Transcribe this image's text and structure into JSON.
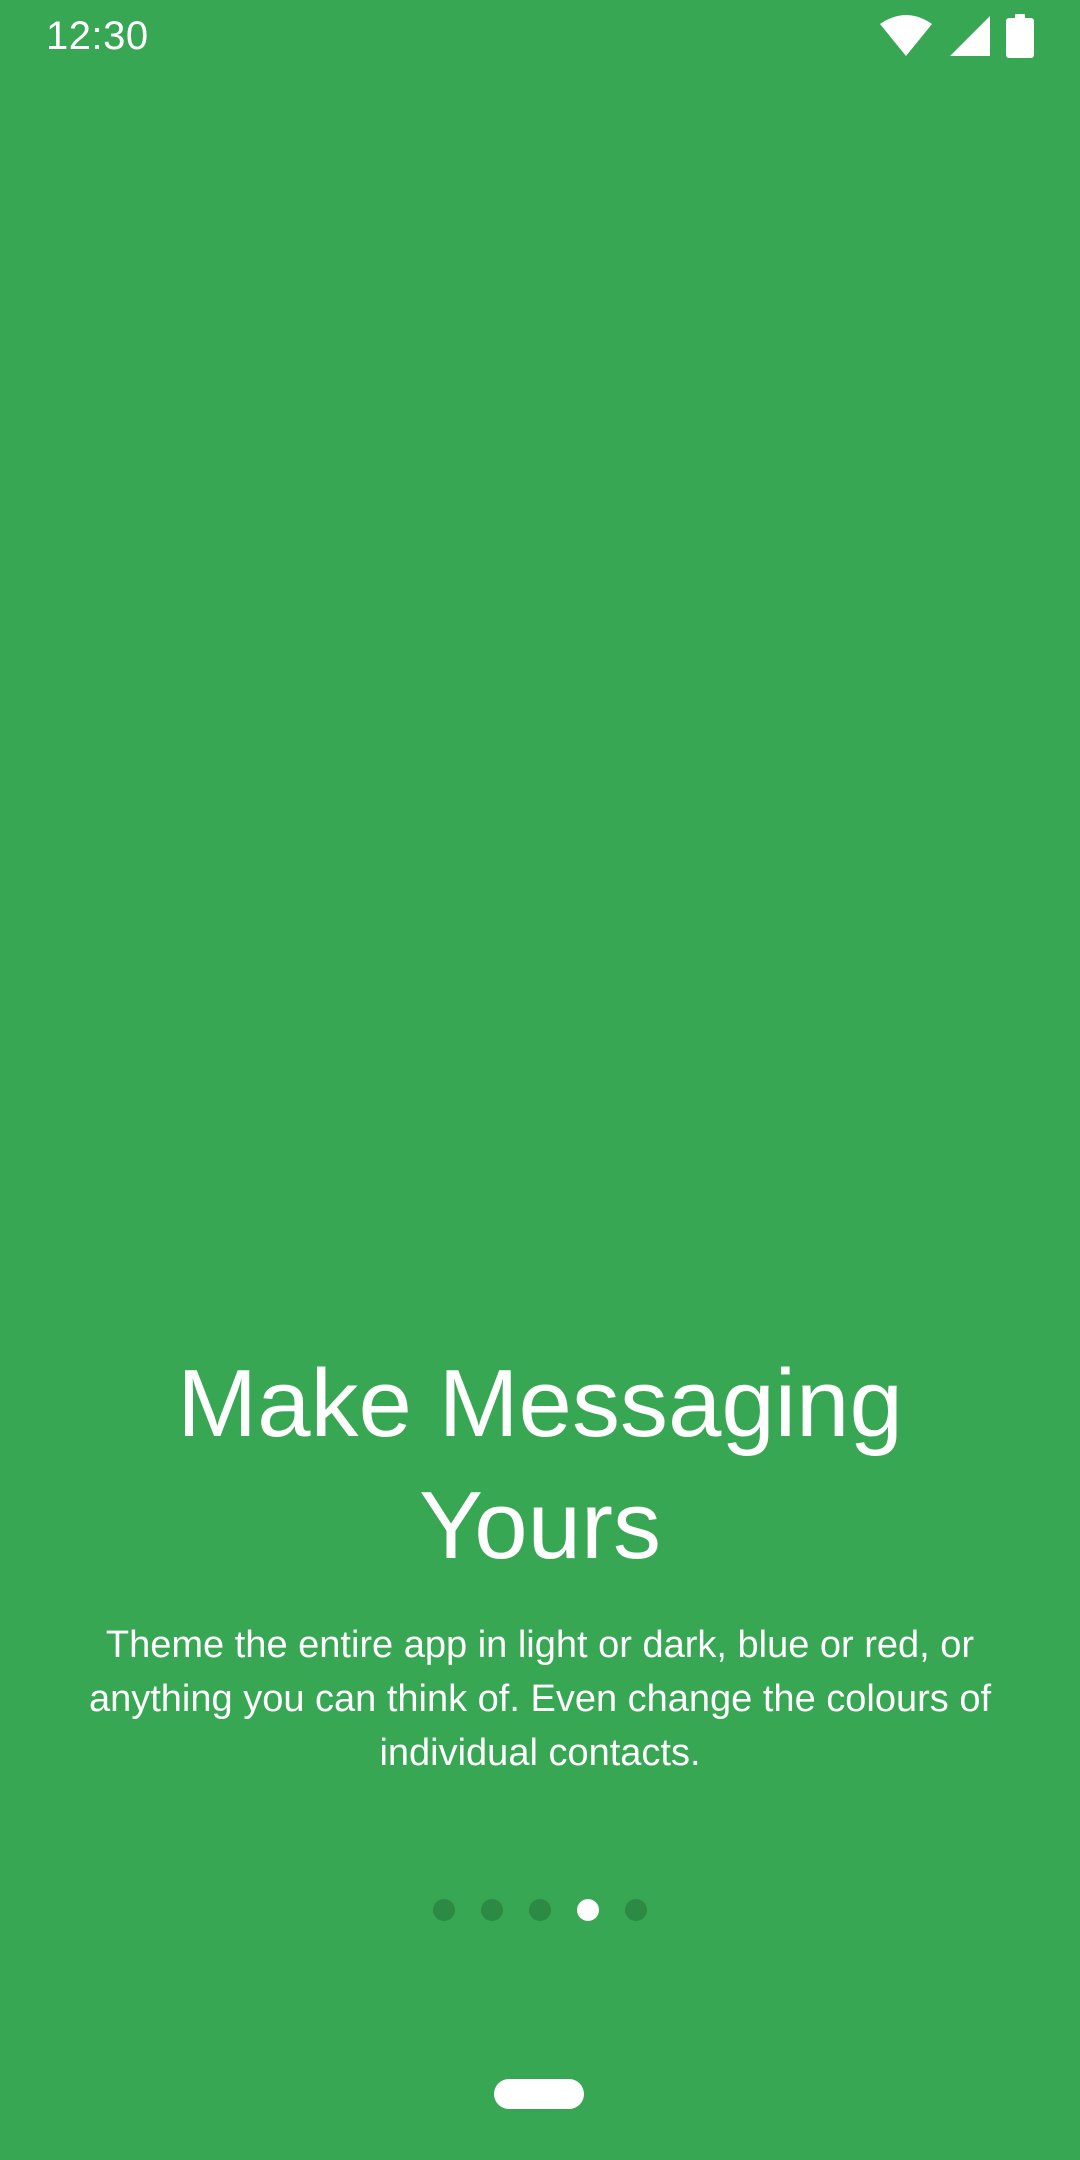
{
  "theme": {
    "background": "#37a753",
    "indicator_inactive": "#2c8a44",
    "indicator_active": "#ffffff",
    "text": "#ffffff"
  },
  "status_bar": {
    "time": "12:30",
    "icons": [
      "wifi-icon",
      "cell-signal-icon",
      "battery-icon"
    ]
  },
  "onboarding": {
    "title": "Make Messaging Yours",
    "description": "Theme the entire app in light or dark, blue or red, or anything you can think of. Even change the colours of individual contacts."
  },
  "page_indicator": {
    "total_pages": 5,
    "current_page": 4
  }
}
